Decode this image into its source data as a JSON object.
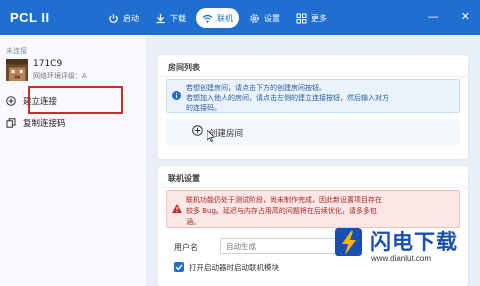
{
  "app": {
    "title": "PCL II"
  },
  "nav": [
    {
      "label": "启动",
      "icon": "power-icon"
    },
    {
      "label": "下载",
      "icon": "download-icon"
    },
    {
      "label": "联机",
      "icon": "wifi-icon",
      "active": true
    },
    {
      "label": "设置",
      "icon": "gear-icon"
    },
    {
      "label": "更多",
      "icon": "grid-icon"
    }
  ],
  "window_controls": {
    "minimize": "—",
    "close": "✕"
  },
  "sidebar": {
    "status": "未连接",
    "player": {
      "name": "171C9",
      "sub": "网络环境评级：A"
    },
    "links": [
      {
        "label": "建立连接",
        "icon": "plus-circle-icon"
      },
      {
        "label": "复制连接码",
        "icon": "copy-icon"
      }
    ]
  },
  "room_list": {
    "title": "房间列表",
    "info": [
      "若想创建房间，请点击下方的创建房间按钮。",
      "若想加入他人的房间，请点击左侧的建立连接按钮，然后输入对方",
      "的连接码。"
    ],
    "create_label": "创建房间"
  },
  "online_settings": {
    "title": "联机设置",
    "warning": [
      "联机功能仍处于测试阶段，尚未制作完成，因此新设置项目存在",
      "较多 Bug。延迟与内存占用高的问题将在后续优化，请多多包",
      "涵。"
    ],
    "username_label": "用户名",
    "username_placeholder": "自动生成",
    "auto_start_label": "打开启动器时启动联机模块",
    "auto_start_checked": true
  },
  "watermark": {
    "text": "闪电下载",
    "url": "www.dianlut.com"
  },
  "colors": {
    "accent": "#1f6fd0",
    "highlight": "#cf2a2a",
    "warning_bg": "#fde6e6",
    "info_bg": "#eaf2fc"
  }
}
